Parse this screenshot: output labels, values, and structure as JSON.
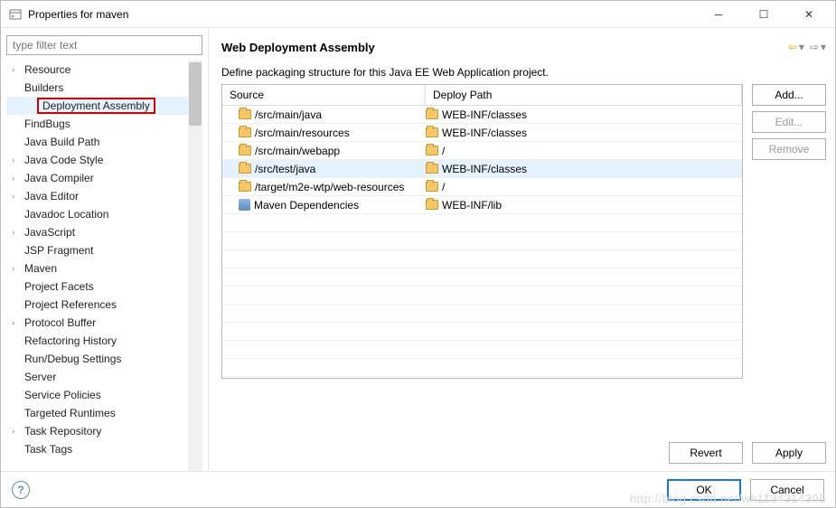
{
  "window": {
    "title": "Properties for maven"
  },
  "filter": {
    "placeholder": "type filter text"
  },
  "tree": [
    {
      "label": "Resource",
      "expandable": true
    },
    {
      "label": "Builders",
      "expandable": false
    },
    {
      "label": "Deployment Assembly",
      "expandable": false,
      "highlighted": true,
      "selected": true
    },
    {
      "label": "FindBugs",
      "expandable": false
    },
    {
      "label": "Java Build Path",
      "expandable": false
    },
    {
      "label": "Java Code Style",
      "expandable": true
    },
    {
      "label": "Java Compiler",
      "expandable": true
    },
    {
      "label": "Java Editor",
      "expandable": true
    },
    {
      "label": "Javadoc Location",
      "expandable": false
    },
    {
      "label": "JavaScript",
      "expandable": true
    },
    {
      "label": "JSP Fragment",
      "expandable": false
    },
    {
      "label": "Maven",
      "expandable": true
    },
    {
      "label": "Project Facets",
      "expandable": false
    },
    {
      "label": "Project References",
      "expandable": false
    },
    {
      "label": "Protocol Buffer",
      "expandable": true
    },
    {
      "label": "Refactoring History",
      "expandable": false
    },
    {
      "label": "Run/Debug Settings",
      "expandable": false
    },
    {
      "label": "Server",
      "expandable": false
    },
    {
      "label": "Service Policies",
      "expandable": false
    },
    {
      "label": "Targeted Runtimes",
      "expandable": false
    },
    {
      "label": "Task Repository",
      "expandable": true
    },
    {
      "label": "Task Tags",
      "expandable": false
    }
  ],
  "main": {
    "title": "Web Deployment Assembly",
    "description": "Define packaging structure for this Java EE Web Application project.",
    "columns": {
      "source": "Source",
      "deploy": "Deploy Path"
    },
    "rows": [
      {
        "icon": "folder",
        "source": "/src/main/java",
        "deploy": "WEB-INF/classes",
        "deployIcon": "folder"
      },
      {
        "icon": "folder",
        "source": "/src/main/resources",
        "deploy": "WEB-INF/classes",
        "deployIcon": "folder"
      },
      {
        "icon": "folder",
        "source": "/src/main/webapp",
        "deploy": "/",
        "deployIcon": "folder"
      },
      {
        "icon": "folder",
        "source": "/src/test/java",
        "deploy": "WEB-INF/classes",
        "deployIcon": "folder",
        "selected": true
      },
      {
        "icon": "folder",
        "source": "/target/m2e-wtp/web-resources",
        "deploy": "/",
        "deployIcon": "folder"
      },
      {
        "icon": "jar",
        "source": "Maven Dependencies",
        "deploy": "WEB-INF/lib",
        "deployIcon": "folder"
      }
    ],
    "buttons": {
      "add": "Add...",
      "edit": "Edit...",
      "remove": "Remove",
      "revert": "Revert",
      "apply": "Apply"
    }
  },
  "footer": {
    "ok": "OK",
    "cancel": "Cancel"
  },
  "watermark": "http://blog.csdn.net/wk1134314305"
}
